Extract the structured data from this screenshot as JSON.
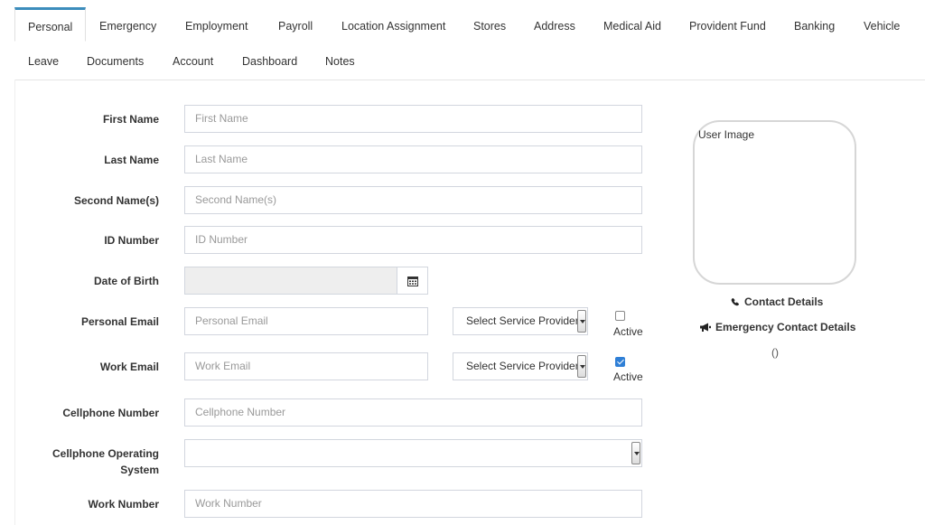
{
  "tabs": [
    {
      "label": "Personal",
      "active": true
    },
    {
      "label": "Emergency"
    },
    {
      "label": "Employment"
    },
    {
      "label": "Payroll"
    },
    {
      "label": "Location Assignment"
    },
    {
      "label": "Stores"
    },
    {
      "label": "Address"
    },
    {
      "label": "Medical Aid"
    },
    {
      "label": "Provident Fund"
    },
    {
      "label": "Banking"
    },
    {
      "label": "Vehicle"
    },
    {
      "label": "Leave"
    },
    {
      "label": "Documents"
    },
    {
      "label": "Account"
    },
    {
      "label": "Dashboard"
    },
    {
      "label": "Notes"
    }
  ],
  "form": {
    "first_name": {
      "label": "First Name",
      "placeholder": "First Name"
    },
    "last_name": {
      "label": "Last Name",
      "placeholder": "Last Name"
    },
    "second_names": {
      "label": "Second Name(s)",
      "placeholder": "Second Name(s)"
    },
    "id_number": {
      "label": "ID Number",
      "placeholder": "ID Number"
    },
    "dob": {
      "label": "Date of Birth",
      "value": ""
    },
    "personal_email": {
      "label": "Personal Email",
      "placeholder": "Personal Email",
      "provider": "Select Service Provider",
      "active_label": "Active",
      "active_checked": false
    },
    "work_email": {
      "label": "Work Email",
      "placeholder": "Work Email",
      "provider": "Select Service Provider",
      "active_label": "Active",
      "active_checked": true
    },
    "cellphone": {
      "label": "Cellphone Number",
      "placeholder": "Cellphone Number"
    },
    "cell_os": {
      "label_line1": "Cellphone Operating",
      "label_line2": "System",
      "value": ""
    },
    "work_number": {
      "label": "Work Number",
      "placeholder": "Work Number"
    }
  },
  "side": {
    "user_image_label": "User Image",
    "contact_details": "Contact Details",
    "emergency_contact_details": "Emergency Contact Details",
    "paren_text": "()"
  },
  "icons": {
    "calendar": "calendar-icon",
    "phone": "phone-icon",
    "bullhorn": "bullhorn-icon"
  },
  "colors": {
    "accent": "#3c8dbc",
    "checkbox": "#2f7fd6"
  }
}
